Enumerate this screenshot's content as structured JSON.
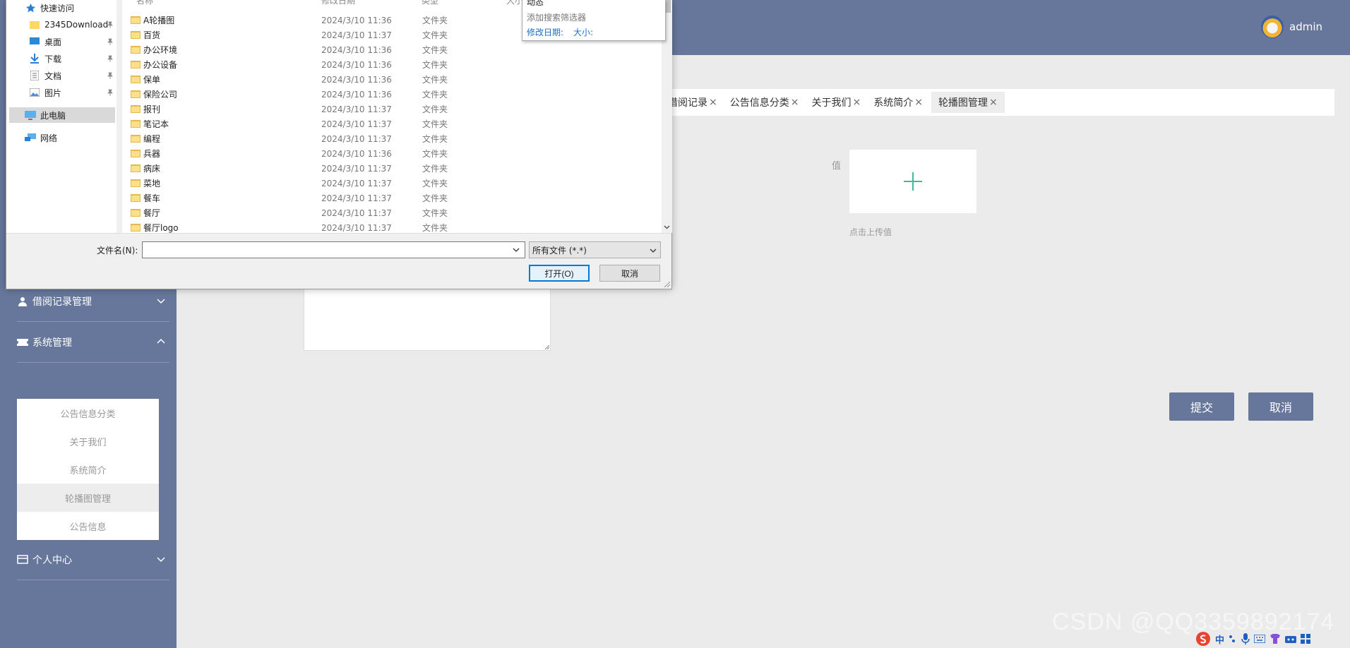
{
  "header": {
    "username": "admin"
  },
  "sidebar": {
    "menus": [
      {
        "label": "借阅记录管理",
        "icon": "user-icon",
        "expanded": false
      },
      {
        "label": "系统管理",
        "icon": "ticket-icon",
        "expanded": true
      },
      {
        "label": "个人中心",
        "icon": "card-icon",
        "expanded": false
      }
    ],
    "submenu": [
      {
        "label": "公告信息分类"
      },
      {
        "label": "关于我们"
      },
      {
        "label": "系统简介"
      },
      {
        "label": "轮播图管理",
        "active": true
      },
      {
        "label": "公告信息"
      }
    ]
  },
  "tabs": [
    {
      "label": "借阅记录",
      "close": "×"
    },
    {
      "label": "公告信息分类",
      "close": "×"
    },
    {
      "label": "关于我们",
      "close": "×"
    },
    {
      "label": "系统简介",
      "close": "×"
    },
    {
      "label": "轮播图管理",
      "close": "×",
      "active": true
    }
  ],
  "form": {
    "value_label": "值",
    "upload_hint": "点击上传值",
    "submit_label": "提交",
    "cancel_label": "取消"
  },
  "watermark": "CSDN @QQ3359892174",
  "tray": {
    "ime_label": "中"
  },
  "dialog": {
    "columns": [
      "名称",
      "修改日期",
      "类型",
      "大小"
    ],
    "nav": [
      {
        "label": "快速访问",
        "icon": "star-icon"
      },
      {
        "label": "2345Download",
        "icon": "folder-icon",
        "pinned": true
      },
      {
        "label": "桌面",
        "icon": "desktop-icon",
        "pinned": true
      },
      {
        "label": "下载",
        "icon": "download-icon",
        "pinned": true
      },
      {
        "label": "文档",
        "icon": "document-icon",
        "pinned": true
      },
      {
        "label": "图片",
        "icon": "picture-icon",
        "pinned": true
      },
      {
        "label": "此电脑",
        "icon": "computer-icon",
        "selected": true
      },
      {
        "label": "网络",
        "icon": "network-icon"
      }
    ],
    "files": [
      {
        "name": "A轮播图",
        "date": "2024/3/10 11:36",
        "type": "文件夹"
      },
      {
        "name": "百货",
        "date": "2024/3/10 11:37",
        "type": "文件夹"
      },
      {
        "name": "办公环境",
        "date": "2024/3/10 11:36",
        "type": "文件夹"
      },
      {
        "name": "办公设备",
        "date": "2024/3/10 11:36",
        "type": "文件夹"
      },
      {
        "name": "保单",
        "date": "2024/3/10 11:36",
        "type": "文件夹"
      },
      {
        "name": "保险公司",
        "date": "2024/3/10 11:36",
        "type": "文件夹"
      },
      {
        "name": "报刊",
        "date": "2024/3/10 11:37",
        "type": "文件夹"
      },
      {
        "name": "笔记本",
        "date": "2024/3/10 11:37",
        "type": "文件夹"
      },
      {
        "name": "编程",
        "date": "2024/3/10 11:37",
        "type": "文件夹"
      },
      {
        "name": "兵器",
        "date": "2024/3/10 11:36",
        "type": "文件夹"
      },
      {
        "name": "病床",
        "date": "2024/3/10 11:37",
        "type": "文件夹"
      },
      {
        "name": "菜地",
        "date": "2024/3/10 11:37",
        "type": "文件夹"
      },
      {
        "name": "餐车",
        "date": "2024/3/10 11:37",
        "type": "文件夹"
      },
      {
        "name": "餐厅",
        "date": "2024/3/10 11:37",
        "type": "文件夹"
      },
      {
        "name": "餐厅logo",
        "date": "2024/3/10 11:37",
        "type": "文件夹"
      }
    ],
    "search_popup": {
      "top_text": "动态",
      "add_filter": "添加搜索筛选器",
      "date_filter": "修改日期:",
      "size_filter": "大小:"
    },
    "filename_label": "文件名(N):",
    "filename_value": "",
    "filetype_value": "所有文件 (*.*)",
    "open_label": "打开(O)",
    "cancel_label": "取消"
  },
  "colors": {
    "header": "#66779b",
    "sidebar": "#66779b",
    "button": "#66779b",
    "plus": "#3dbb9a"
  }
}
